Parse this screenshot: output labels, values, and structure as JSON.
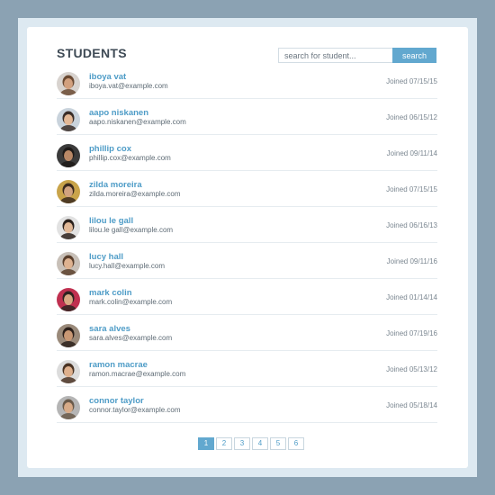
{
  "header": {
    "title": "STUDENTS"
  },
  "search": {
    "placeholder": "search for student...",
    "button_label": "search"
  },
  "students": [
    {
      "name": "iboya vat",
      "email": "iboya.vat@example.com",
      "joined": "Joined 07/15/15",
      "skin": "#d2a07e",
      "hair": "#6b4a33",
      "bg": "#d8d3cf"
    },
    {
      "name": "aapo niskanen",
      "email": "aapo.niskanen@example.com",
      "joined": "Joined 06/15/12",
      "skin": "#e3b896",
      "hair": "#3a2d28",
      "bg": "#c9d3dc"
    },
    {
      "name": "phillip cox",
      "email": "phillip.cox@example.com",
      "joined": "Joined 09/11/14",
      "skin": "#b98866",
      "hair": "#1e1a18",
      "bg": "#3b3b3b"
    },
    {
      "name": "zilda moreira",
      "email": "zilda.moreira@example.com",
      "joined": "Joined 07/15/15",
      "skin": "#d1a37f",
      "hair": "#3a2a1d",
      "bg": "#c9a44a"
    },
    {
      "name": "lilou le gall",
      "email": "lilou.le gall@example.com",
      "joined": "Joined 06/16/13",
      "skin": "#e1b897",
      "hair": "#2b211c",
      "bg": "#e2e2e2"
    },
    {
      "name": "lucy hall",
      "email": "lucy.hall@example.com",
      "joined": "Joined 09/11/16",
      "skin": "#deb290",
      "hair": "#5a3f2c",
      "bg": "#c8c0b8"
    },
    {
      "name": "mark colin",
      "email": "mark.colin@example.com",
      "joined": "Joined 01/14/14",
      "skin": "#d9a883",
      "hair": "#2e2320",
      "bg": "#c03050"
    },
    {
      "name": "sara alves",
      "email": "sara.alves@example.com",
      "joined": "Joined 07/19/16",
      "skin": "#c99874",
      "hair": "#2c201a",
      "bg": "#9a8a7a"
    },
    {
      "name": "ramon macrae",
      "email": "ramon.macrae@example.com",
      "joined": "Joined 05/13/12",
      "skin": "#deb08d",
      "hair": "#4a3323",
      "bg": "#dcdcdc"
    },
    {
      "name": "connor taylor",
      "email": "connor.taylor@example.com",
      "joined": "Joined 05/18/14",
      "skin": "#d8ab88",
      "hair": "#6a5a4a",
      "bg": "#b5b5b5"
    }
  ],
  "pagination": {
    "pages": [
      "1",
      "2",
      "3",
      "4",
      "5",
      "6"
    ],
    "current": "1"
  },
  "colors": {
    "accent": "#62a8cf",
    "link": "#4e9cc7",
    "backdrop": "#8ba2b3"
  }
}
